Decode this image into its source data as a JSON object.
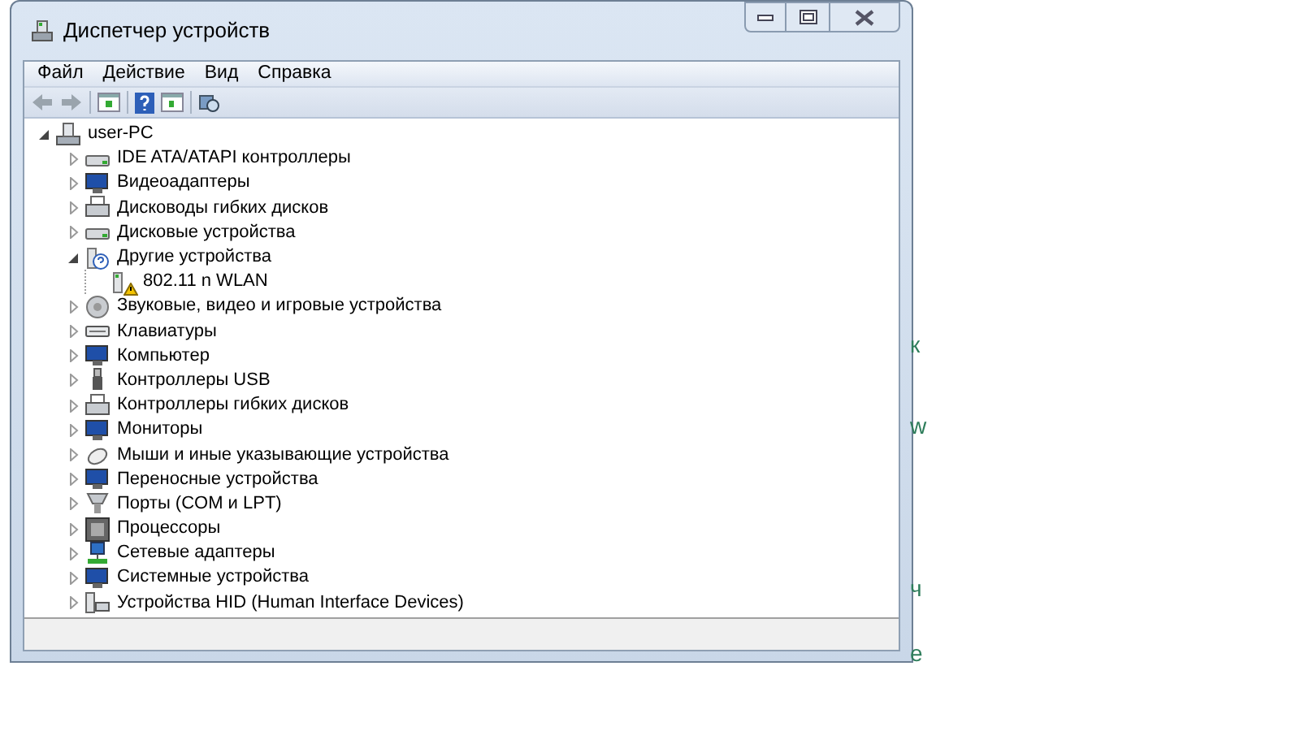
{
  "window": {
    "title": "Диспетчер устройств"
  },
  "menu": [
    {
      "label": "Файл"
    },
    {
      "label": "Действие"
    },
    {
      "label": "Вид"
    },
    {
      "label": "Справка"
    }
  ],
  "tree": {
    "label": "user-PC",
    "expanded": true,
    "children": [
      {
        "label": "IDE ATA/ATAPI контроллеры",
        "expanded": false
      },
      {
        "label": "Видеоадаптеры",
        "expanded": false
      },
      {
        "label": "Дисководы гибких дисков",
        "expanded": false
      },
      {
        "label": "Дисковые устройства",
        "expanded": false
      },
      {
        "label": "Другие устройства",
        "expanded": true,
        "children": [
          {
            "label": "802.11 n WLAN",
            "warning": true
          }
        ]
      },
      {
        "label": "Звуковые, видео и игровые устройства",
        "expanded": false
      },
      {
        "label": "Клавиатуры",
        "expanded": false
      },
      {
        "label": "Компьютер",
        "expanded": false
      },
      {
        "label": "Контроллеры USB",
        "expanded": false
      },
      {
        "label": "Контроллеры гибких дисков",
        "expanded": false
      },
      {
        "label": "Мониторы",
        "expanded": false
      },
      {
        "label": "Мыши и иные указывающие устройства",
        "expanded": false
      },
      {
        "label": "Переносные устройства",
        "expanded": false
      },
      {
        "label": "Порты (COM и LPT)",
        "expanded": false
      },
      {
        "label": "Процессоры",
        "expanded": false
      },
      {
        "label": "Сетевые адаптеры",
        "expanded": false
      },
      {
        "label": "Системные устройства",
        "expanded": false
      },
      {
        "label": "Устройства HID (Human Interface Devices)",
        "expanded": false
      }
    ]
  },
  "background_fragments": [
    "к",
    "w",
    "ч",
    "е"
  ]
}
